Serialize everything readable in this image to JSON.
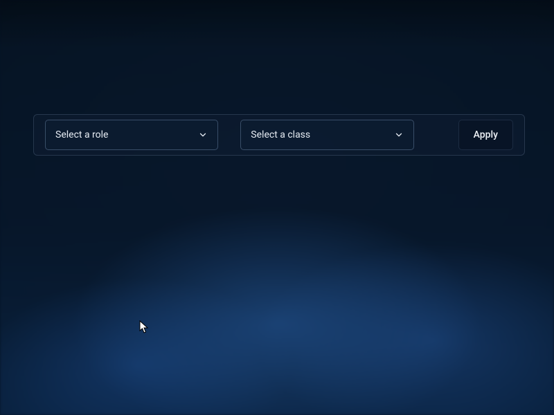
{
  "filters": {
    "role_select": {
      "placeholder": "Select a role"
    },
    "class_select": {
      "placeholder": "Select a class"
    },
    "apply_label": "Apply"
  }
}
